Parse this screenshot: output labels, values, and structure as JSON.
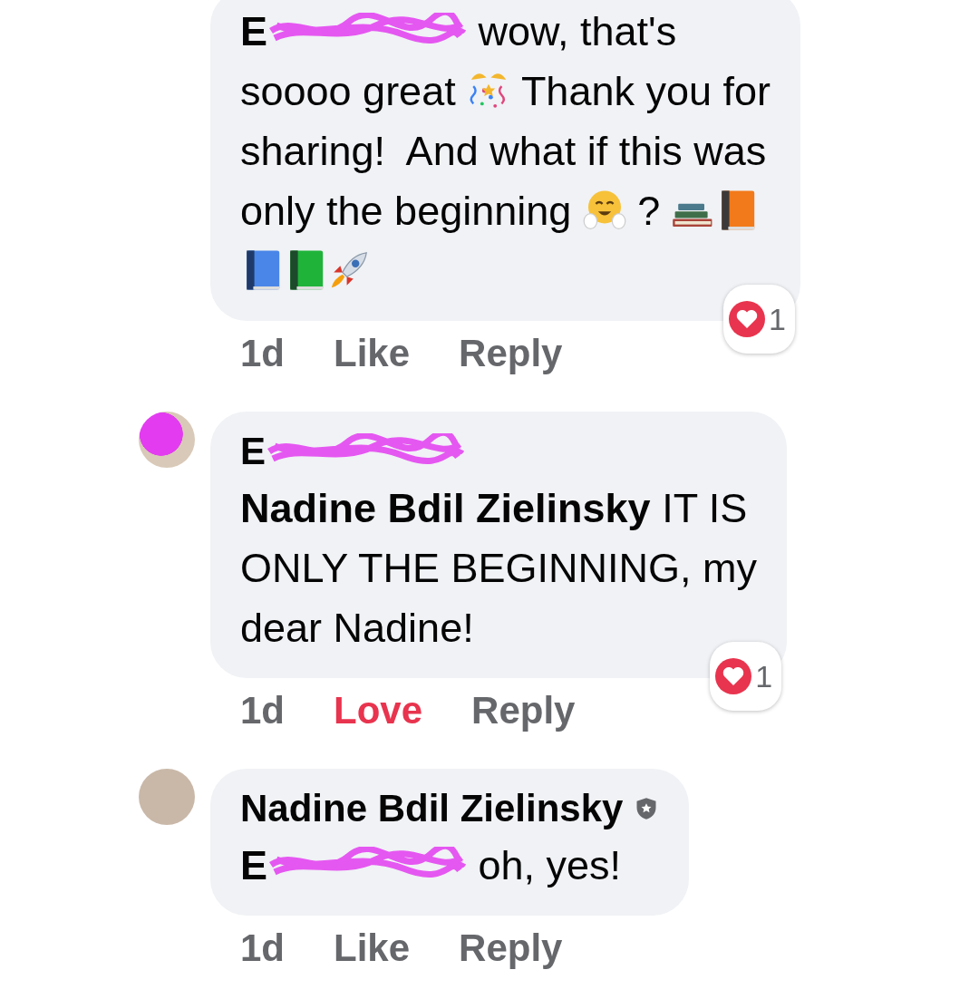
{
  "comments": [
    {
      "lines": [
        [
          {
            "kind": "mention",
            "text": "E"
          },
          {
            "kind": "redaction"
          },
          {
            "kind": "text",
            "text": " wow, that's"
          }
        ],
        [
          {
            "kind": "text",
            "text": "soooo great "
          },
          {
            "kind": "party-popper"
          },
          {
            "kind": "text",
            "text": " Thank you for"
          }
        ],
        [
          {
            "kind": "text",
            "text": "sharing!  And what if this was"
          }
        ],
        [
          {
            "kind": "text",
            "text": "only the beginning "
          },
          {
            "kind": "hugging-face"
          },
          {
            "kind": "text",
            "text": " ? "
          },
          {
            "kind": "books"
          },
          {
            "kind": "orange-book"
          }
        ],
        [
          {
            "kind": "blue-book"
          },
          {
            "kind": "green-book"
          },
          {
            "kind": "rocket"
          }
        ]
      ],
      "time": "1d",
      "reaction": {
        "label": "Like",
        "selected": false
      },
      "reply": "Reply",
      "reaction_count": "1"
    },
    {
      "avatar": {
        "redacted": true
      },
      "author": {
        "parts": [
          {
            "kind": "mention",
            "text": "E"
          },
          {
            "kind": "redaction"
          }
        ]
      },
      "lines": [
        [
          {
            "kind": "mention",
            "text": "Nadine Bdil Zielinsky"
          },
          {
            "kind": "text",
            "text": " IT IS"
          }
        ],
        [
          {
            "kind": "text",
            "text": "ONLY THE BEGINNING, my"
          }
        ],
        [
          {
            "kind": "text",
            "text": "dear Nadine!"
          }
        ]
      ],
      "time": "1d",
      "reaction": {
        "label": "Love",
        "selected": true
      },
      "reply": "Reply",
      "reaction_count": "1"
    },
    {
      "avatar": {
        "redacted": false
      },
      "author": {
        "parts": [
          {
            "kind": "mention",
            "text": "Nadine Bdil Zielinsky"
          },
          {
            "kind": "badge"
          }
        ]
      },
      "lines": [
        [
          {
            "kind": "mention",
            "text": "E"
          },
          {
            "kind": "redaction"
          },
          {
            "kind": "text",
            "text": " oh, yes!"
          }
        ]
      ],
      "time": "1d",
      "reaction": {
        "label": "Like",
        "selected": false
      },
      "reply": "Reply"
    }
  ]
}
